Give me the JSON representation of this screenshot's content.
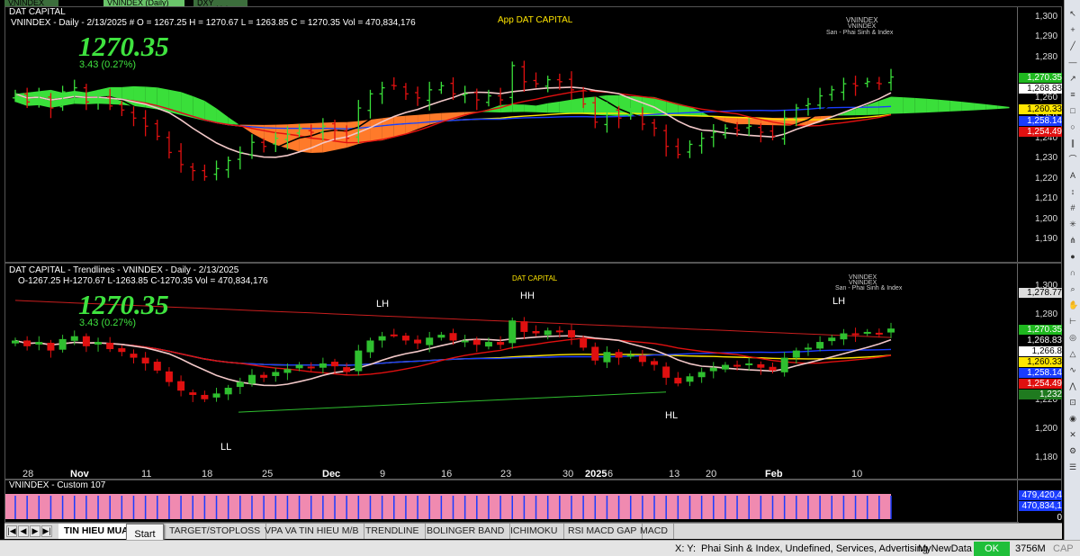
{
  "top_tabs": [
    "VNINDEX (Daily)",
    "VNINDEX (Daily)",
    "DXY (Weekly)"
  ],
  "pane1": {
    "title": "DAT CAPITAL",
    "header": "VNINDEX - Daily - 2/13/2025  #  O = 1267.25  H = 1270.67  L = 1263.85  C = 1270.35  Vol = 470,834,176",
    "big_price": "1270.35",
    "change": "3.43  (0.27%)",
    "app_label": "App DAT CAPITAL",
    "wm_title": "VNINDEX",
    "wm_sub": "VNINDEX",
    "wm_line": "San - Phai Sinh & Index",
    "axis_ticks": [
      "1,300",
      "1,290",
      "1,280",
      "1,270",
      "1,260",
      "1,250",
      "1,240",
      "1,230",
      "1,220",
      "1,210",
      "1,200",
      "1,190"
    ],
    "price_labels": [
      {
        "text": "1,270.35",
        "bg": "#1fb81f",
        "fg": "#ffffff"
      },
      {
        "text": "1,268.83",
        "bg": "#ffffff",
        "fg": "#000000"
      },
      {
        "text": "1,260.33",
        "bg": "#ffe600",
        "fg": "#000000"
      },
      {
        "text": "1,258.14",
        "bg": "#1a3cff",
        "fg": "#ffffff"
      },
      {
        "text": "1,254.49",
        "bg": "#e01010",
        "fg": "#ffffff"
      }
    ]
  },
  "pane2": {
    "title": "DAT CAPITAL - Trendlines - VNINDEX - Daily - 2/13/2025",
    "header": "O-1267.25  H-1270.67  L-1263.85  C-1270.35  Vol = 470,834,176",
    "big_price": "1270.35",
    "change": "3.43  (0.27%)",
    "app_label": "DAT CAPITAL",
    "wm_title": "VNINDEX",
    "wm_sub": "VNINDEX",
    "wm_line": "San - Phai Sinh & Index",
    "axis_ticks": [
      "1,300",
      "1,280",
      "1,260",
      "1,240",
      "1,220",
      "1,200",
      "1,180"
    ],
    "price_labels": [
      {
        "text": "1,278.77",
        "bg": "#dddddd",
        "fg": "#000000"
      },
      {
        "text": "1,270.35",
        "bg": "#1fb81f",
        "fg": "#ffffff"
      },
      {
        "text": "1,268.83",
        "bg": "#000000",
        "fg": "#ffffff"
      },
      {
        "text": "1,266.8",
        "bg": "#ffffff",
        "fg": "#000000"
      },
      {
        "text": "1,260.33",
        "bg": "#ffe600",
        "fg": "#000000"
      },
      {
        "text": "1,258.14",
        "bg": "#1a3cff",
        "fg": "#ffffff"
      },
      {
        "text": "1,254.49",
        "bg": "#e01010",
        "fg": "#ffffff"
      },
      {
        "text": "1,232",
        "bg": "#1f7a1f",
        "fg": "#ffffff"
      }
    ],
    "markers": {
      "lh1": "LH",
      "hh": "HH",
      "lh2": "LH",
      "ll": "LL",
      "hl": "HL"
    },
    "x_labels": [
      "28",
      "Nov",
      "11",
      "18",
      "25",
      "Dec",
      "9",
      "16",
      "23",
      "30",
      "2025",
      "6",
      "13",
      "20",
      "Feb",
      "10"
    ]
  },
  "pane3": {
    "title": "VNINDEX - Custom 107",
    "labels": [
      {
        "text": "479,420,4",
        "bg": "#1a3cff",
        "fg": "#ffffff"
      },
      {
        "text": "470,834,1",
        "bg": "#1a3cff",
        "fg": "#ffffff"
      },
      {
        "text": "0",
        "bg": "#000000",
        "fg": "#ffffff"
      }
    ]
  },
  "tabs": [
    "TIN HIEU MUA",
    "TARGET/STOPLOSS",
    "VPA VA TIN HIEU M/B",
    "TRENDLINE",
    "BOLINGER BAND",
    "ICHIMOKU",
    "RSI MACD GAP",
    "MACD"
  ],
  "nav": [
    "|◀",
    "◀",
    "▶",
    "▶|",
    "|◀",
    "◀",
    "▶",
    "▶|"
  ],
  "tooltip": "Start",
  "status": {
    "xy": "X:  Y:",
    "info": "Phai Sinh & Index, Undefined, Services, Advertising",
    "db": "MyNewData",
    "ok": "OK",
    "mem": "3756M",
    "cap": "CAP"
  },
  "chart_data": {
    "type": "candlestick",
    "symbol": "VNINDEX",
    "x_labels": [
      "28",
      "Nov",
      "11",
      "18",
      "25",
      "Dec",
      "9",
      "16",
      "23",
      "30",
      "2025",
      "6",
      "13",
      "20",
      "Feb",
      "10"
    ],
    "last": {
      "open": 1267.25,
      "high": 1270.67,
      "low": 1263.85,
      "close": 1270.35,
      "volume": 470834176
    },
    "closes": [
      1262,
      1258,
      1261,
      1255,
      1263,
      1265,
      1258,
      1261,
      1256,
      1254,
      1250,
      1246,
      1241,
      1233,
      1227,
      1224,
      1221,
      1225,
      1229,
      1233,
      1238,
      1236,
      1240,
      1242,
      1245,
      1243,
      1246,
      1244,
      1240,
      1255,
      1262,
      1265,
      1266,
      1262,
      1260,
      1264,
      1266,
      1262,
      1262,
      1259,
      1261,
      1259,
      1276,
      1268,
      1267,
      1269,
      1268,
      1264,
      1257,
      1248,
      1254,
      1250,
      1252,
      1247,
      1245,
      1236,
      1232,
      1237,
      1240,
      1243,
      1245,
      1244,
      1246,
      1243,
      1241,
      1250,
      1255,
      1257,
      1261,
      1264,
      1267,
      1266,
      1268,
      1267,
      1270.35
    ]
  }
}
